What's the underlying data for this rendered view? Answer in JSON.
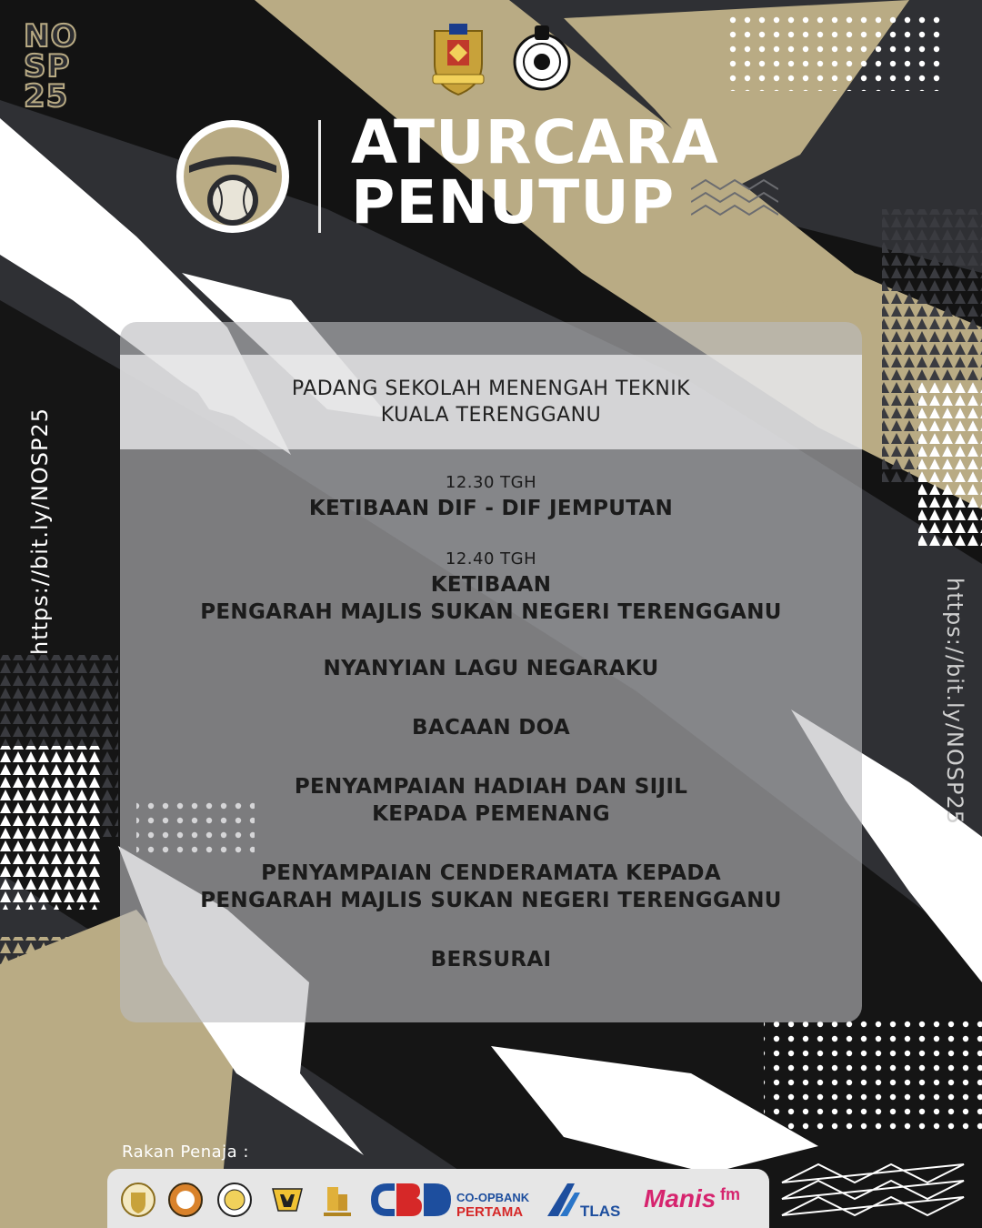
{
  "brand": {
    "tag_lines": [
      "NO",
      "SP",
      "25"
    ],
    "colors": {
      "gold": "#b9ab84",
      "dark": "#2f3034",
      "black": "#141414",
      "white": "#ffffff"
    }
  },
  "header": {
    "emblems": [
      "state-crest-icon",
      "association-badge-icon"
    ],
    "logo_icon": "slowpitch-championship-logo-icon",
    "title_lines": [
      "ATURCARA",
      "PENUTUP"
    ]
  },
  "side_links": {
    "left": "https://bit.ly/NOSP25",
    "right": "https://bit.ly/NOSP25"
  },
  "venue": {
    "lines": [
      "PADANG SEKOLAH MENENGAH TEKNIK",
      "KUALA TERENGGANU"
    ]
  },
  "schedule": [
    {
      "time": "12.30 TGH",
      "lines": [
        "KETIBAAN DIF - DIF JEMPUTAN"
      ]
    },
    {
      "time": "12.40 TGH",
      "lines": [
        "KETIBAAN",
        "PENGARAH MAJLIS SUKAN NEGERI TERENGGANU"
      ]
    },
    {
      "time": "",
      "lines": [
        "NYANYIAN LAGU NEGARAKU"
      ]
    },
    {
      "time": "",
      "lines": [
        "BACAAN DOA"
      ]
    },
    {
      "time": "",
      "lines": [
        "PENYAMPAIAN HADIAH DAN SIJIL",
        "KEPADA PEMENANG"
      ]
    },
    {
      "time": "",
      "lines": [
        "PENYAMPAIAN CENDERAMATA KEPADA",
        "PENGARAH MAJLIS SUKAN NEGERI TERENGGANU"
      ]
    },
    {
      "time": "",
      "lines": [
        "BERSURAI"
      ]
    }
  ],
  "sponsors": {
    "label": "Rakan Penaja :",
    "logos": [
      {
        "icon": "state-crest-logo-icon"
      },
      {
        "icon": "round-badge-logo-icon"
      },
      {
        "icon": "association-seal-logo-icon"
      },
      {
        "icon": "ms-logo-icon"
      },
      {
        "icon": "building-logo-icon"
      },
      {
        "icon": "cbd-logo-icon",
        "text": "CO-OPBANK",
        "subtext": "PERTAMA"
      },
      {
        "icon": "atlas-logo-icon",
        "text": "TLAS"
      },
      {
        "icon": "manis-fm-logo-icon",
        "text": "Manis",
        "subtext": "fm"
      }
    ]
  }
}
